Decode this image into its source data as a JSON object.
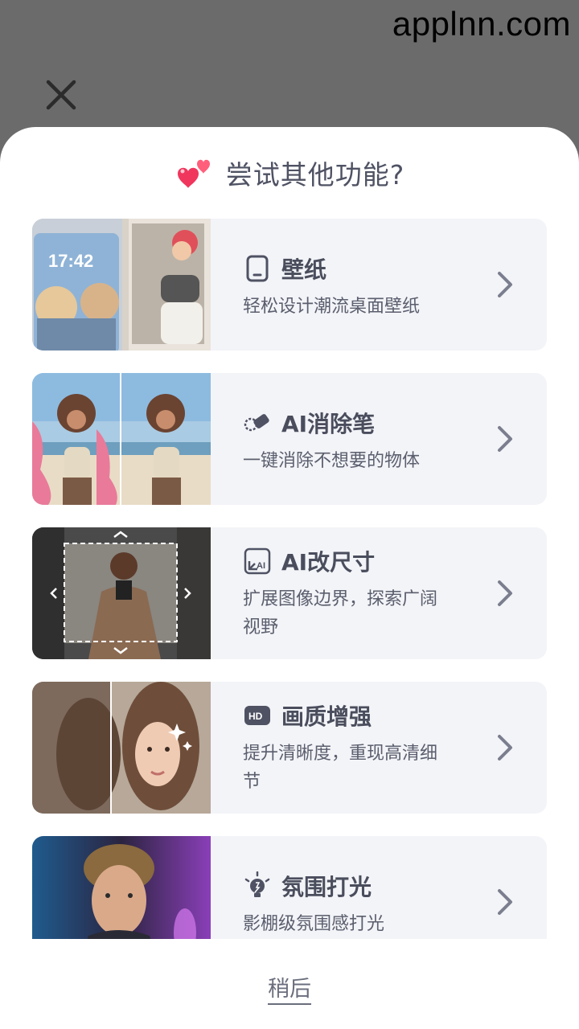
{
  "watermark": "applnn.com",
  "sheet": {
    "title": "尝试其他功能?",
    "later_label": "稍后"
  },
  "wallpaper_thumb": {
    "clock": "17:42"
  },
  "features": [
    {
      "id": "wallpaper",
      "icon": "phone-icon",
      "title": "壁纸",
      "desc": "轻松设计潮流桌面壁纸"
    },
    {
      "id": "eraser",
      "icon": "magic-eraser-icon",
      "title": "AI消除笔",
      "desc": "一键消除不想要的物体"
    },
    {
      "id": "resize",
      "icon": "ai-resize-icon",
      "title": "AI改尺寸",
      "desc": "扩展图像边界，探索广阔视野"
    },
    {
      "id": "enhance",
      "icon": "hd-icon",
      "title": "画质增强",
      "desc": "提升清晰度，重现高清细节"
    },
    {
      "id": "lighting",
      "icon": "lightbulb-icon",
      "title": "氛围打光",
      "desc": "影棚级氛围感打光"
    }
  ],
  "colors": {
    "accent_text": "#4a4d5c",
    "card_bg": "#f3f4f8",
    "heart": "#f0365d"
  }
}
